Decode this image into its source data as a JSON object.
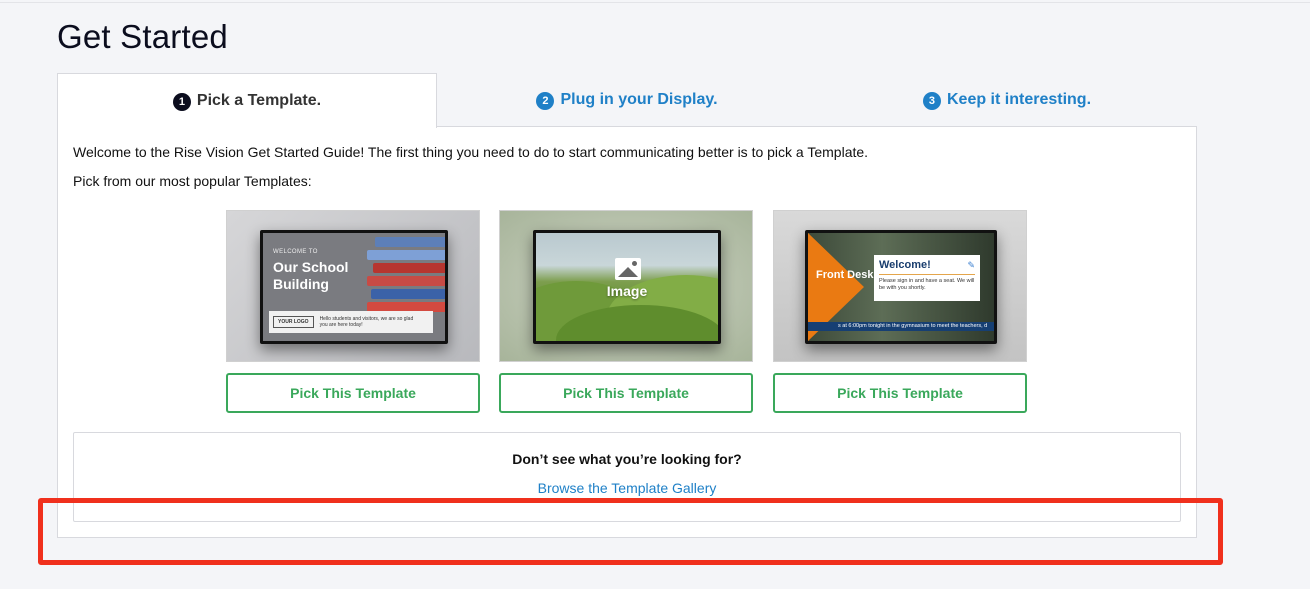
{
  "page": {
    "title": "Get Started"
  },
  "tabs": [
    {
      "num": "1",
      "label": "Pick a Template."
    },
    {
      "num": "2",
      "label": "Plug in your Display."
    },
    {
      "num": "3",
      "label": "Keep it interesting."
    }
  ],
  "intro": {
    "line1": "Welcome to the Rise Vision Get Started Guide! The first thing you need to do to start communicating better is to pick a Template.",
    "line2": "Pick from our most popular Templates:"
  },
  "templates": [
    {
      "welcome": "WELCOME TO",
      "title": "Our School Building",
      "logo": "YOUR LOGO",
      "message": "Hello students and visitors, we are so glad you are here today!",
      "button": "Pick This Template"
    },
    {
      "label": "Image",
      "button": "Pick This Template"
    },
    {
      "side": "Front Desk",
      "welcome": "Welcome!",
      "message": "Please sign in and have a seat. We will be with you shortly.",
      "ticker": "s at 6:00pm tonight in the gymnasium to meet the teachers, d",
      "button": "Pick This Template"
    }
  ],
  "looking": {
    "title": "Don’t see what you’re looking for?",
    "link": "Browse the Template Gallery"
  },
  "colors": {
    "link": "#1f80c7",
    "button_green": "#3aa85b",
    "highlight_red": "#f0301d"
  }
}
